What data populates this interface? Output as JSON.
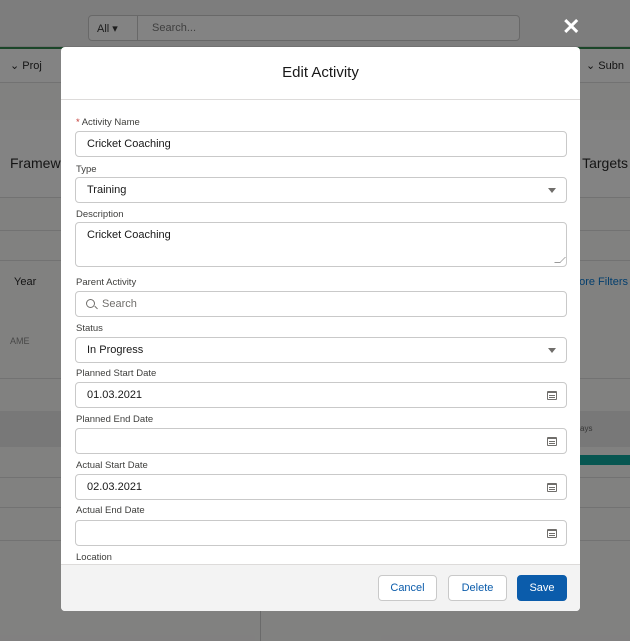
{
  "background": {
    "search_scope": "All ▾",
    "search_placeholder": "Search...",
    "nav_left": "⌄   Proj",
    "nav_right": "⌄  Subn",
    "framework_label": "Framew",
    "targets_label": "Targets",
    "year_label": "Year",
    "more_filters_label": "ore Filters",
    "name_col": "AME",
    "days_label": "ays"
  },
  "modal": {
    "title": "Edit Activity",
    "close_glyph": "✕",
    "fields": {
      "activity_name": {
        "label": "Activity Name",
        "required_mark": "*",
        "value": "Cricket Coaching"
      },
      "type": {
        "label": "Type",
        "value": "Training"
      },
      "description": {
        "label": "Description",
        "value": "Cricket Coaching"
      },
      "parent_activity": {
        "label": "Parent Activity",
        "placeholder": "Search"
      },
      "status": {
        "label": "Status",
        "value": "In Progress"
      },
      "planned_start_date": {
        "label": "Planned Start Date",
        "value": "01.03.2021"
      },
      "planned_end_date": {
        "label": "Planned End Date",
        "value": ""
      },
      "actual_start_date": {
        "label": "Actual Start Date",
        "value": "02.03.2021"
      },
      "actual_end_date": {
        "label": "Actual End Date",
        "value": ""
      },
      "location": {
        "label": "Location"
      }
    },
    "footer": {
      "cancel_label": "Cancel",
      "delete_label": "Delete",
      "save_label": "Save"
    }
  },
  "colors": {
    "brand": "#0b5cab",
    "required": "#c23934",
    "overlay": "rgba(8,7,7,0.5)"
  }
}
